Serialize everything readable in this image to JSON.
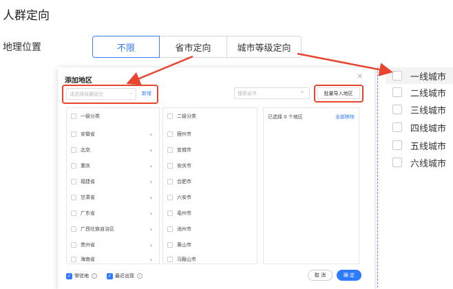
{
  "header": {
    "title": "人群定向",
    "geo_label": "地理位置"
  },
  "segment": {
    "options": [
      "不限",
      "省市定向",
      "城市等级定向"
    ],
    "selected": "不限"
  },
  "dialog": {
    "title": "添加地区",
    "close": "×",
    "combo_placeholder": "请选择收藏组合",
    "new_label": "新增",
    "search_placeholder": "搜索省市",
    "batch_import": "批量导入地区",
    "col1_header": "一级分类",
    "col2_header": "二级分类",
    "provinces": [
      "安徽省",
      "北京",
      "重庆",
      "福建省",
      "甘肃省",
      "广东省",
      "广西壮族自治区",
      "贵州省",
      "海南省"
    ],
    "cities": [
      "宿州市",
      "宣城市",
      "安庆市",
      "合肥市",
      "六安市",
      "亳州市",
      "池州市",
      "黄山市",
      "马鞍山市"
    ],
    "selected_count": "已选择 0 个地区",
    "remove_all": "全部移除",
    "footer": {
      "resident": "常驻地",
      "recent": "最近出现",
      "cancel": "取 消",
      "ok": "确 定"
    }
  },
  "city_tiers": [
    "一线城市",
    "二线城市",
    "三线城市",
    "四线城市",
    "五线城市",
    "六线城市"
  ],
  "colors": {
    "accent": "#2f7bff",
    "annotation": "#e8442e"
  }
}
